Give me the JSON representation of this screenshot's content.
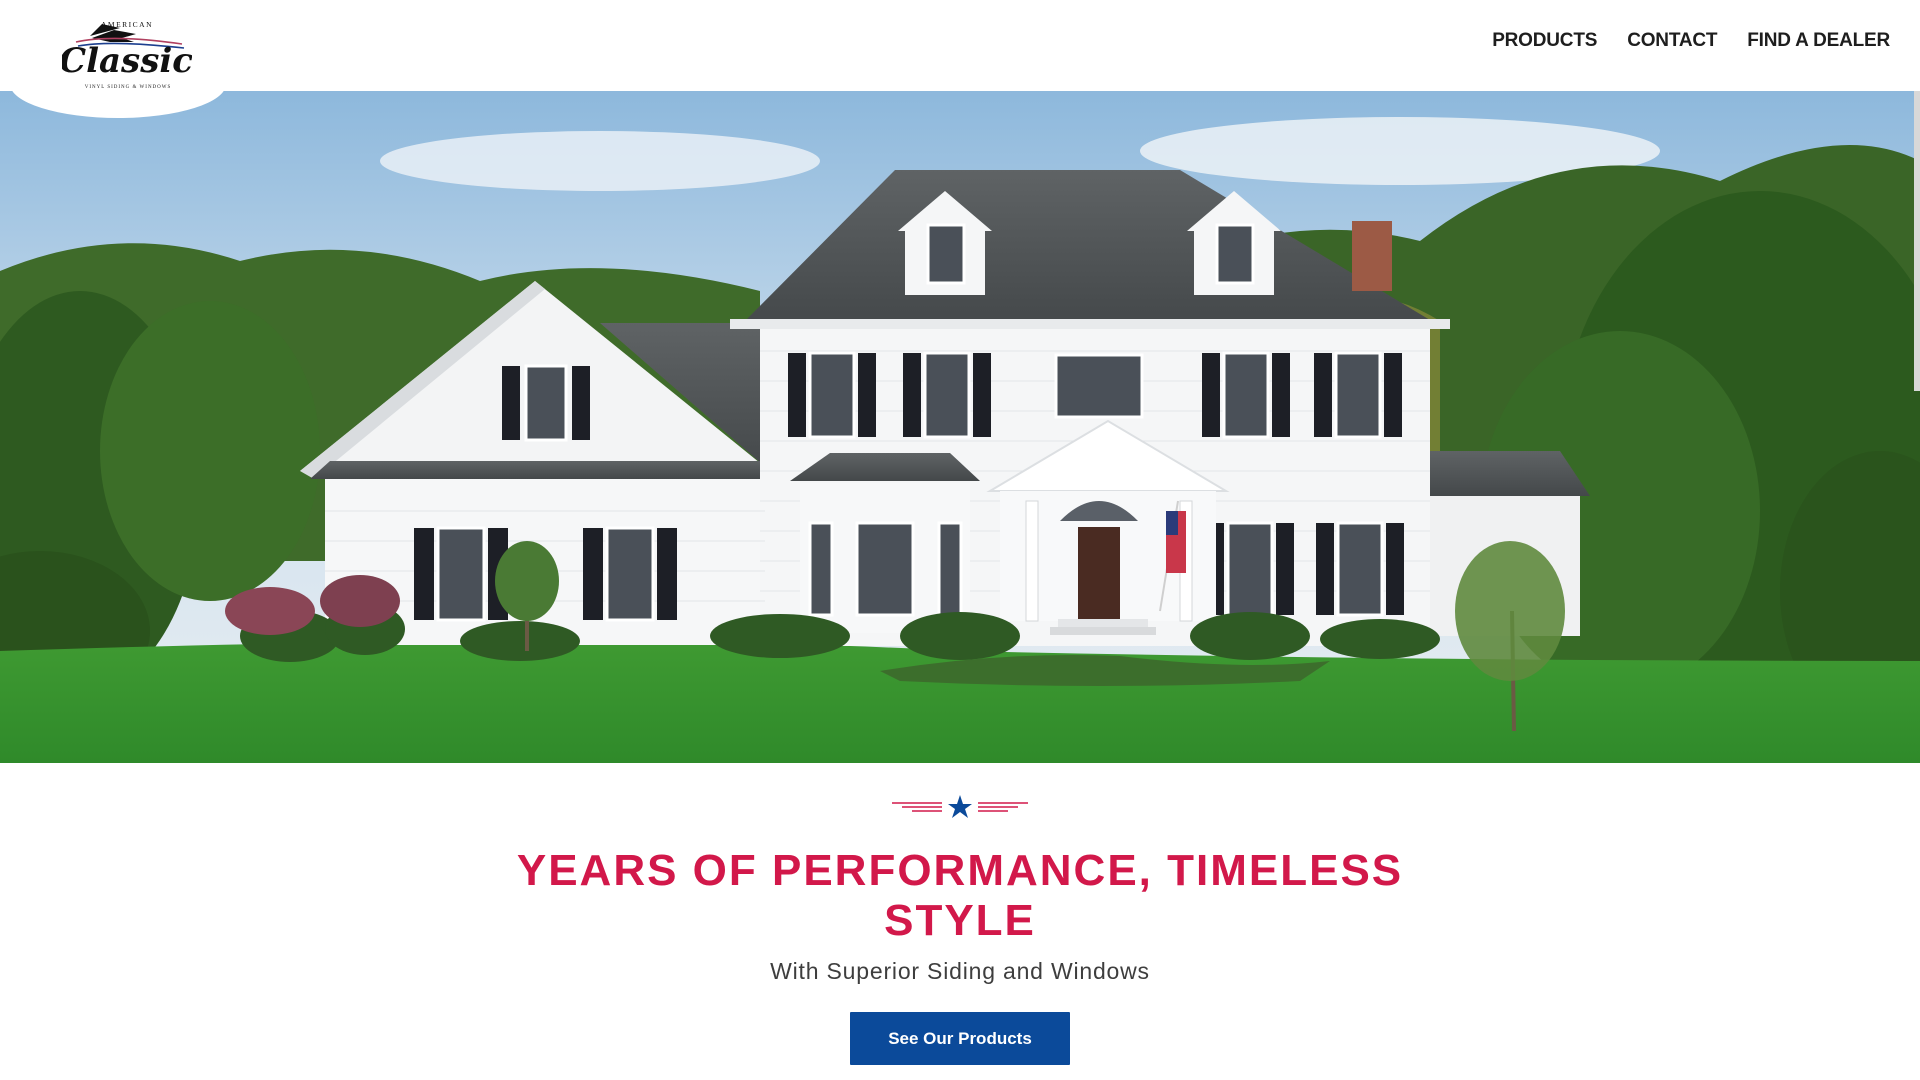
{
  "brand": {
    "logo_top": "AMERICAN",
    "logo_main": "Classic",
    "logo_tagline": "VINYL SIDING & WINDOWS"
  },
  "nav": {
    "items": [
      {
        "label": "PRODUCTS"
      },
      {
        "label": "CONTACT"
      },
      {
        "label": "FIND A DEALER"
      }
    ]
  },
  "hero": {
    "headline": "YEARS OF PERFORMANCE, TIMELESS STYLE",
    "subheadline": "With Superior Siding and Windows",
    "cta_label": "See Our Products"
  },
  "icons": {
    "divider": "star-divider-icon",
    "logo_bird": "eagle-icon"
  },
  "colors": {
    "accent_red": "#d2184a",
    "button_blue": "#0b4a9a",
    "nav_text": "#1e1e1e",
    "body_text": "#3e3e3e"
  }
}
